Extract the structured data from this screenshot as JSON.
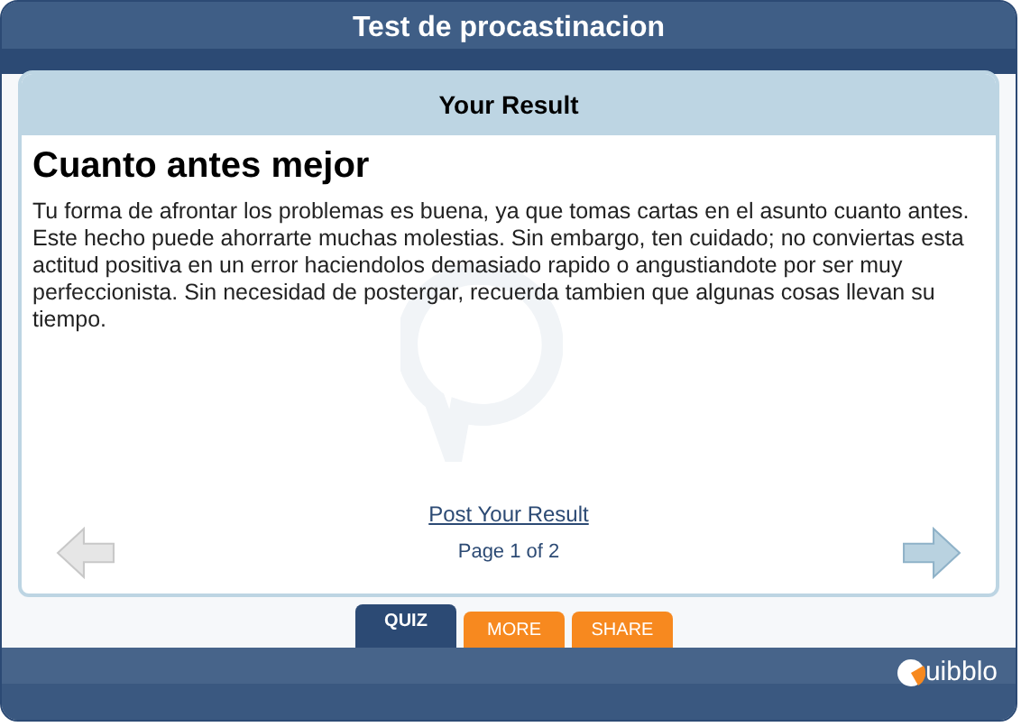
{
  "window": {
    "title": "Test de procastinacion"
  },
  "panel": {
    "header": "Your Result",
    "heading": "Cuanto antes mejor",
    "body": "Tu forma de afrontar los problemas es buena, ya que tomas cartas en el asunto cuanto antes. Este hecho puede ahorrarte muchas molestias. Sin embargo, ten cuidado; no conviertas esta actitud positiva en un error haciendolos demasiado rapido o angustiandote por ser muy perfeccionista. Sin necesidad de postergar, recuerda tambien que algunas cosas llevan su tiempo.",
    "link": "Post Your Result",
    "page": "Page 1 of 2",
    "prev": {
      "disabled": true
    },
    "next": {
      "disabled": false
    }
  },
  "tabs": [
    {
      "label": "QUIZ",
      "selected": true
    },
    {
      "label": "MORE",
      "selected": false
    },
    {
      "label": "SHARE",
      "selected": false
    }
  ],
  "logo": "uibblo"
}
